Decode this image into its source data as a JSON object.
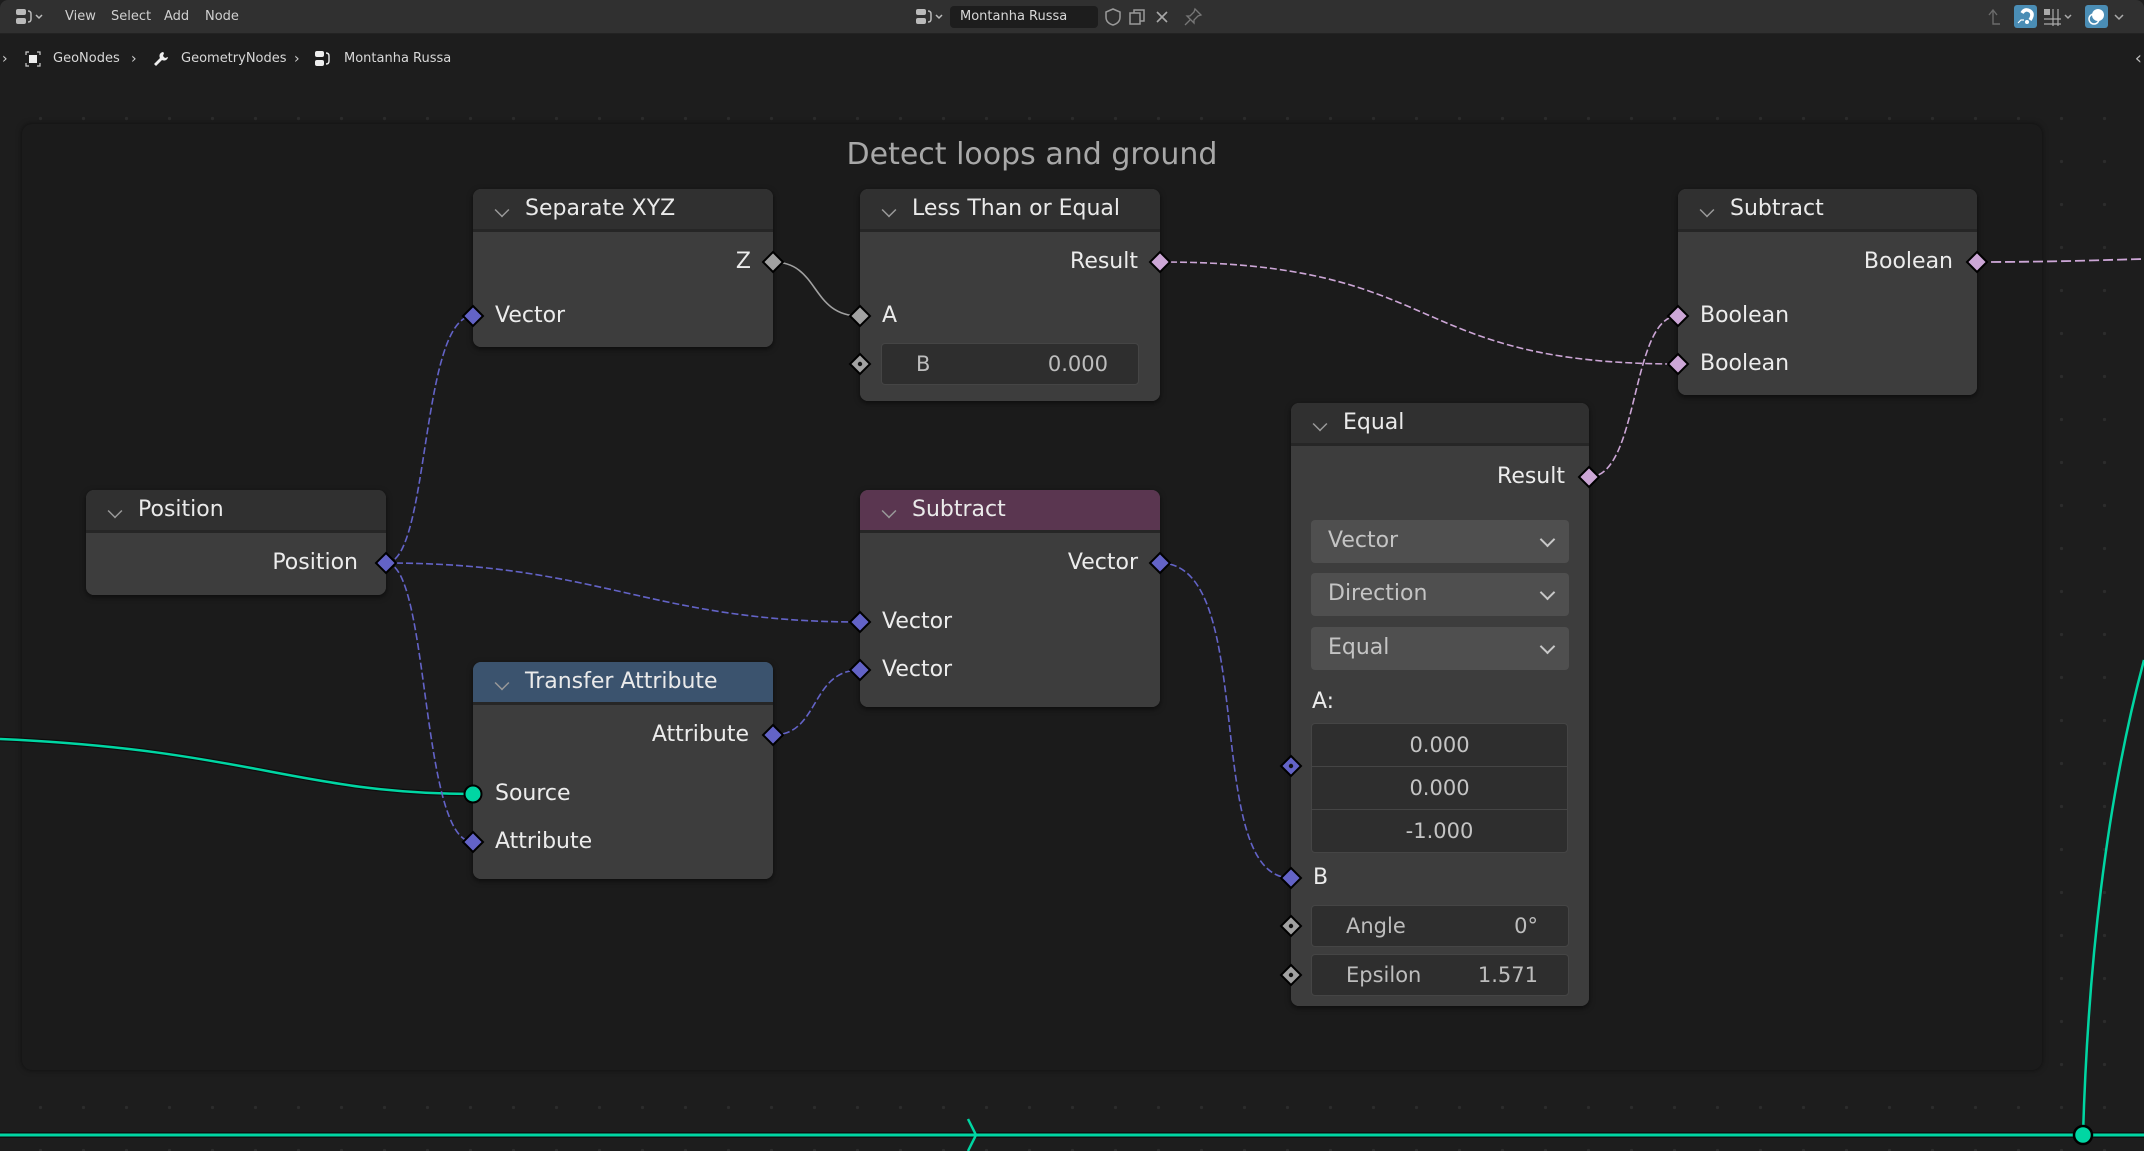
{
  "header": {
    "menus": [
      "View",
      "Select",
      "Add",
      "Node"
    ],
    "node_tree_name": "Montanha Russa",
    "icons": [
      "editor-type-icon",
      "fake-user-shield-icon",
      "duplicate-icon",
      "unlink-close-icon",
      "pin-icon",
      "parent-up-icon",
      "snapping-icon",
      "snap-grid-icon",
      "overlay-icon"
    ]
  },
  "breadcrumb": {
    "items": [
      {
        "icon": "object-icon",
        "label": "GeoNodes"
      },
      {
        "icon": "wrench-modifier-icon",
        "label": "GeometryNodes"
      },
      {
        "icon": "node-tree-icon",
        "label": "Montanha Russa"
      }
    ]
  },
  "frame": {
    "label": "Detect loops and ground"
  },
  "nodes": {
    "position": {
      "title": "Position",
      "outputs": [
        "Position"
      ]
    },
    "separate_xyz": {
      "title": "Separate XYZ",
      "outputs": [
        "Z"
      ],
      "inputs": [
        "Vector"
      ]
    },
    "less_than_equal": {
      "title": "Less Than or Equal",
      "outputs": [
        "Result"
      ],
      "inputs": [
        "A"
      ],
      "b_field": {
        "label": "B",
        "value": "0.000"
      }
    },
    "subtract_vector": {
      "title": "Subtract",
      "outputs": [
        "Vector"
      ],
      "inputs": [
        "Vector",
        "Vector"
      ]
    },
    "transfer_attribute": {
      "title": "Transfer Attribute",
      "outputs": [
        "Attribute"
      ],
      "inputs": [
        "Source",
        "Attribute"
      ]
    },
    "equal": {
      "title": "Equal",
      "outputs": [
        "Result"
      ],
      "dropdowns": [
        "Vector",
        "Direction",
        "Equal"
      ],
      "a_label": "A:",
      "a_values": [
        "0.000",
        "0.000",
        "-1.000"
      ],
      "b_label": "B",
      "angle": {
        "label": "Angle",
        "value": "0°"
      },
      "epsilon": {
        "label": "Epsilon",
        "value": "1.571"
      }
    },
    "subtract_boolean": {
      "title": "Subtract",
      "outputs": [
        "Boolean"
      ],
      "inputs": [
        "Boolean",
        "Boolean"
      ]
    }
  },
  "colors": {
    "vector_socket": "#6363c7",
    "float_socket": "#a1a1a1",
    "boolean_socket": "#cca6d6",
    "geometry_socket": "#00d6a3",
    "math_header": "#5a3650",
    "attribute_header": "#3b536e",
    "active_icon": "#4a8db5"
  }
}
